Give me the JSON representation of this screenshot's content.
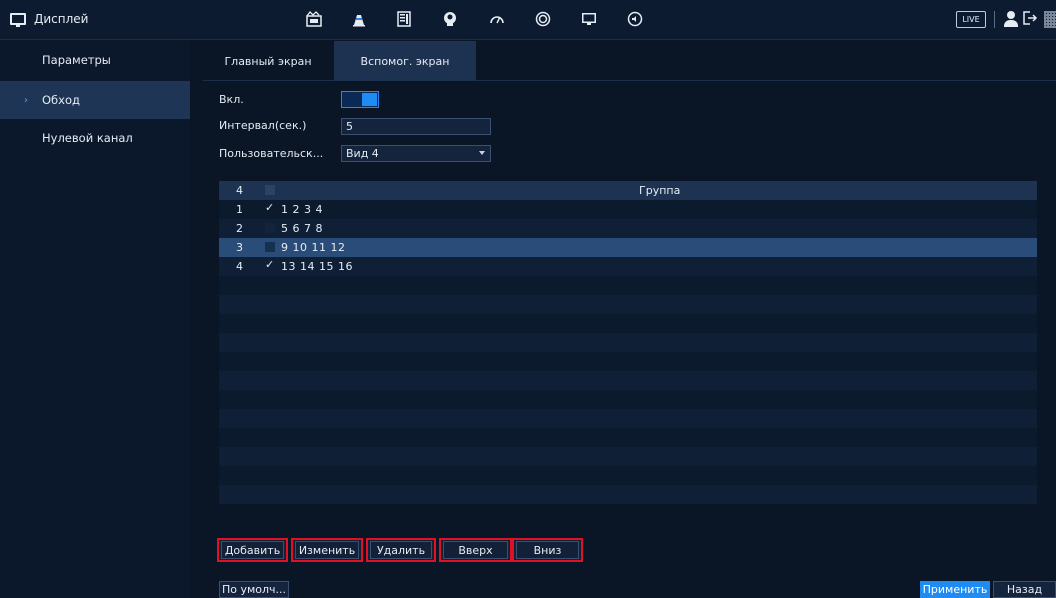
{
  "header": {
    "title": "Дисплей",
    "title_icon": "monitor-icon",
    "nav_icons": [
      "clapper-icon",
      "cone-icon",
      "server-icon",
      "head-icon",
      "gauge-icon",
      "record-icon",
      "monitor-icon",
      "speaker-icon"
    ],
    "live_label": "LIVE",
    "user_icon": "user-icon",
    "logout_icon": "logout-icon",
    "qr_icon": "qr-icon"
  },
  "sidebar": {
    "items": [
      {
        "label": "Параметры",
        "active": false
      },
      {
        "label": "Обход",
        "active": true
      },
      {
        "label": "Нулевой канал",
        "active": false
      }
    ]
  },
  "tabs": [
    {
      "label": "Главный экран",
      "active": false
    },
    {
      "label": "Вспомог. экран",
      "active": true
    }
  ],
  "form": {
    "enable_label": "Вкл.",
    "enable_value": true,
    "interval_label": "Интервал(сек.)",
    "interval_value": "5",
    "custom_label": "Пользовательск...",
    "custom_value": "Вид 4"
  },
  "table": {
    "header_num": "4",
    "header_group": "Группа",
    "rows": [
      {
        "num": "1",
        "checked": true,
        "values": "1 2 3 4",
        "selected": false
      },
      {
        "num": "2",
        "checked": false,
        "values": "5 6 7 8",
        "selected": false
      },
      {
        "num": "3",
        "checked": false,
        "values": "9 10 11 12",
        "selected": true
      },
      {
        "num": "4",
        "checked": true,
        "values": "13 14 15 16",
        "selected": false
      }
    ],
    "tick_symbol": "✓"
  },
  "actions": {
    "add": "Добавить",
    "edit": "Изменить",
    "delete": "Удалить",
    "up": "Вверх",
    "down": "Вниз"
  },
  "footer": {
    "default": "По умолч...",
    "apply": "Применить",
    "back": "Назад"
  },
  "colors": {
    "accent": "#1e8cf2",
    "highlight_border": "#e01025",
    "background": "#0a1526"
  }
}
